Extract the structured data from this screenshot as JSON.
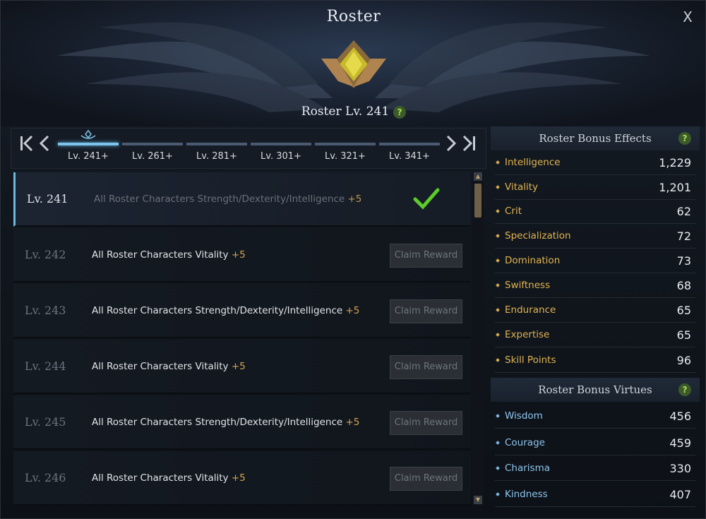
{
  "window": {
    "title": "Roster",
    "close_label": "X"
  },
  "header": {
    "roster_level": "Roster Lv. 241",
    "help_label": "?"
  },
  "tabs": {
    "nav_first": "K",
    "nav_prev": "<",
    "nav_next": ">",
    "nav_last": "K",
    "items": [
      {
        "label": "Lv. 241+",
        "active": true
      },
      {
        "label": "Lv. 261+",
        "active": false
      },
      {
        "label": "Lv. 281+",
        "active": false
      },
      {
        "label": "Lv. 301+",
        "active": false
      },
      {
        "label": "Lv. 321+",
        "active": false
      },
      {
        "label": "Lv. 341+",
        "active": false
      }
    ]
  },
  "rewards": [
    {
      "level": "Lv. 241",
      "text": "All Roster Characters Strength/Dexterity/Intelligence",
      "bonus": "+5",
      "claimed": true
    },
    {
      "level": "Lv. 242",
      "text": "All Roster Characters Vitality",
      "bonus": "+5",
      "claimed": false,
      "button": "Claim Reward"
    },
    {
      "level": "Lv. 243",
      "text": "All Roster Characters Strength/Dexterity/Intelligence",
      "bonus": "+5",
      "claimed": false,
      "button": "Claim Reward"
    },
    {
      "level": "Lv. 244",
      "text": "All Roster Characters Vitality",
      "bonus": "+5",
      "claimed": false,
      "button": "Claim Reward"
    },
    {
      "level": "Lv. 245",
      "text": "All Roster Characters Strength/Dexterity/Intelligence",
      "bonus": "+5",
      "claimed": false,
      "button": "Claim Reward"
    },
    {
      "level": "Lv. 246",
      "text": "All Roster Characters Vitality",
      "bonus": "+5",
      "claimed": false,
      "button": "Claim Reward"
    }
  ],
  "bonus_effects": {
    "title": "Roster Bonus Effects",
    "help_label": "?",
    "stats": [
      {
        "name": "Intelligence",
        "value": "1,229"
      },
      {
        "name": "Vitality",
        "value": "1,201"
      },
      {
        "name": "Crit",
        "value": "62"
      },
      {
        "name": "Specialization",
        "value": "72"
      },
      {
        "name": "Domination",
        "value": "73"
      },
      {
        "name": "Swiftness",
        "value": "68"
      },
      {
        "name": "Endurance",
        "value": "65"
      },
      {
        "name": "Expertise",
        "value": "65"
      },
      {
        "name": "Skill Points",
        "value": "96"
      }
    ]
  },
  "bonus_virtues": {
    "title": "Roster Bonus Virtues",
    "help_label": "?",
    "stats": [
      {
        "name": "Wisdom",
        "value": "456"
      },
      {
        "name": "Courage",
        "value": "459"
      },
      {
        "name": "Charisma",
        "value": "330"
      },
      {
        "name": "Kindness",
        "value": "407"
      }
    ]
  },
  "colors": {
    "accent_blue": "#7cc4ea",
    "stat_gold": "#e1b450",
    "virtue_blue": "#8ec6ee",
    "check_green": "#5ccc2a"
  }
}
